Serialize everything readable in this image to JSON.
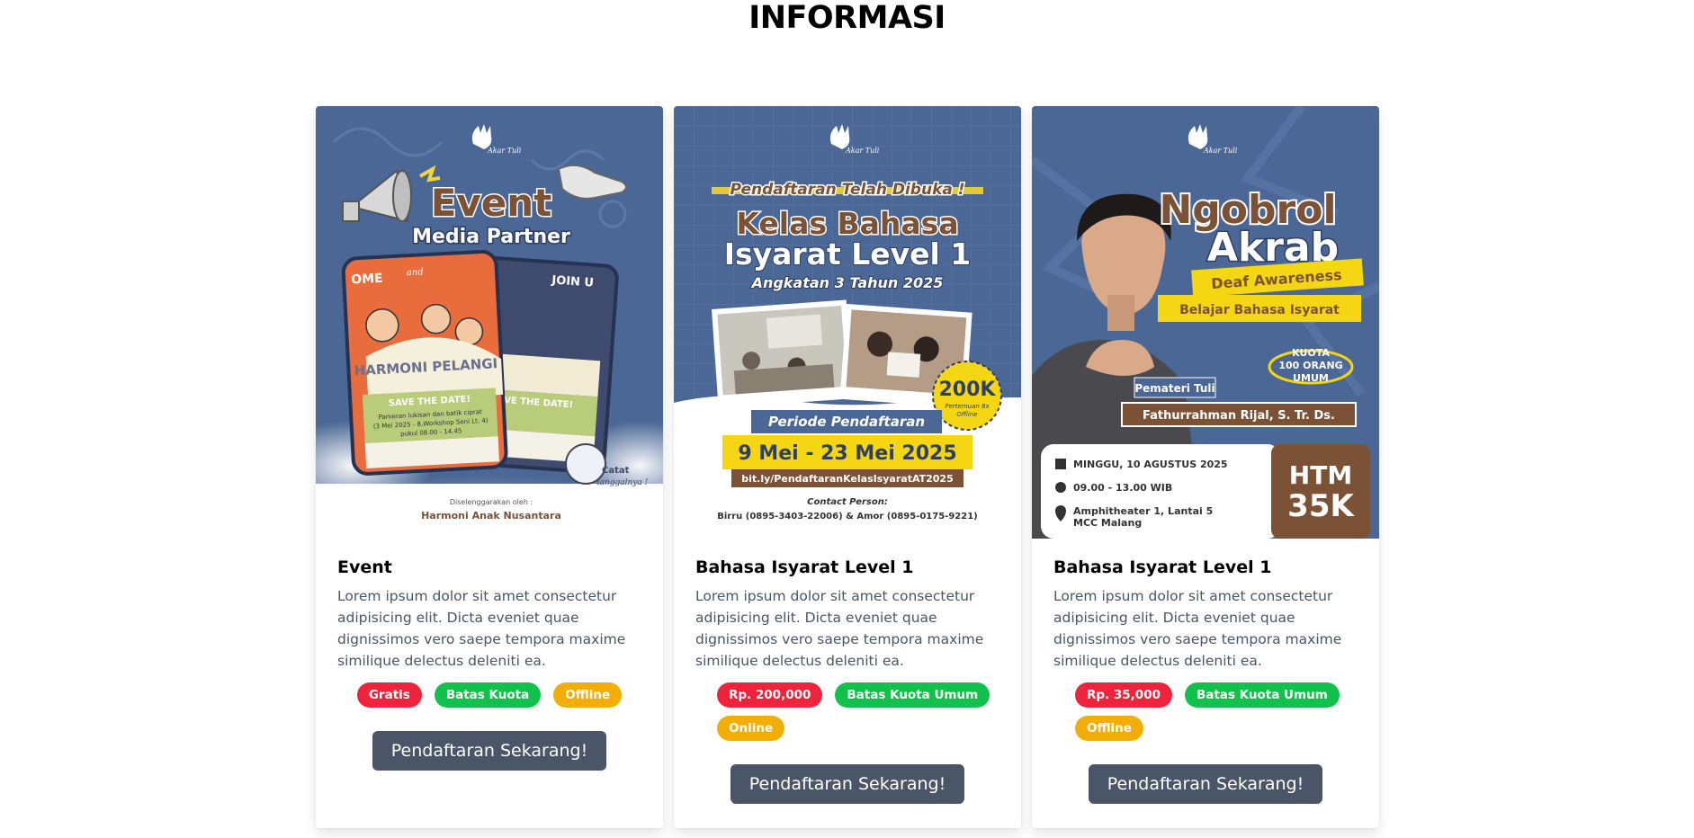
{
  "page": {
    "title": "INFORMASI"
  },
  "colors": {
    "red": "#ef233c",
    "green": "#10c24b",
    "yellow": "#f3ae05",
    "button": "#4a5567",
    "poster_blue": "#4b6796",
    "accent_brown": "#7b5236"
  },
  "cards": [
    {
      "poster": {
        "brand": "Akar Tuli",
        "headline_1": "Event",
        "headline_2": "Media Partner",
        "flyer_left_top": "OME",
        "flyer_and": "and",
        "flyer_right_top": "JOIN U",
        "flyer_title": "HARMONI PELANGI",
        "flyer_save": "SAVE THE DATE!",
        "flyer_line1": "Pameran lukisan dan batik ciprat",
        "flyer_line2": "(3 Mei 2025 - 8,Workshop Seni Lt. 4)",
        "flyer_line3": "pukul 08.00 - 14.45",
        "sticker": "Catat tanggalnya !",
        "organizer_label": "Diselenggarakan oleh :",
        "organizer": "Harmoni Anak Nusantara"
      },
      "title": "Event",
      "description": "Lorem ipsum dolor sit amet consectetur adipisicing elit. Dicta eveniet quae dignissimos vero saepe tempora maxime similique delectus deleniti ea.",
      "badges": [
        {
          "label": "Gratis",
          "color": "red"
        },
        {
          "label": "Batas Kuota",
          "color": "green"
        },
        {
          "label": "Offline",
          "color": "yellow"
        }
      ],
      "cta": "Pendaftaran Sekarang!"
    },
    {
      "poster": {
        "brand": "Akar Tuli",
        "kicker": "Pendaftaran Telah Dibuka !",
        "headline_1": "Kelas Bahasa",
        "headline_2": "Isyarat Level 1",
        "subline": "Angkatan 3 Tahun 2025",
        "price_sticker": "200K",
        "price_sub": "Pertemuan 8x Offline",
        "period_label": "Periode Pendaftaran",
        "period_dates": "9 Mei - 23 Mei 2025",
        "link": "bit.ly/PendaftaranKelasIsyaratAT2025",
        "contact_label": "Contact Person:",
        "contact": "Birru (0895-3403-22006) & Amor (0895-0175-9221)"
      },
      "title": "Bahasa Isyarat Level 1",
      "description": "Lorem ipsum dolor sit amet consectetur adipisicing elit. Dicta eveniet quae dignissimos vero saepe tempora maxime similique delectus deleniti ea.",
      "badges": [
        {
          "label": "Rp. 200,000",
          "color": "red"
        },
        {
          "label": "Batas Kuota Umum",
          "color": "green"
        },
        {
          "label": "Online",
          "color": "yellow"
        }
      ],
      "cta": "Pendaftaran Sekarang!"
    },
    {
      "poster": {
        "brand": "Akar Tuli",
        "headline_1": "Ngobrol",
        "headline_2": "Akrab",
        "tag_1": "Deaf Awareness",
        "tag_2": "Belajar Bahasa Isyarat",
        "quota": "KUOTA 100 ORANG UMUM",
        "speaker_label": "Pemateri Tuli",
        "speaker": "Fathurrahman Rijal, S. Tr. Ds.",
        "date": "MINGGU, 10 AGUSTUS 2025",
        "time": "09.00 - 13.00 WIB",
        "venue_1": "Amphitheater 1, Lantai 5",
        "venue_2": "MCC Malang",
        "htm_label": "HTM",
        "htm_value": "35K"
      },
      "title": "Bahasa Isyarat Level 1",
      "description": "Lorem ipsum dolor sit amet consectetur adipisicing elit. Dicta eveniet quae dignissimos vero saepe tempora maxime similique delectus deleniti ea.",
      "badges": [
        {
          "label": "Rp. 35,000",
          "color": "red"
        },
        {
          "label": "Batas Kuota Umum",
          "color": "green"
        },
        {
          "label": "Offline",
          "color": "yellow"
        }
      ],
      "cta": "Pendaftaran Sekarang!"
    }
  ]
}
